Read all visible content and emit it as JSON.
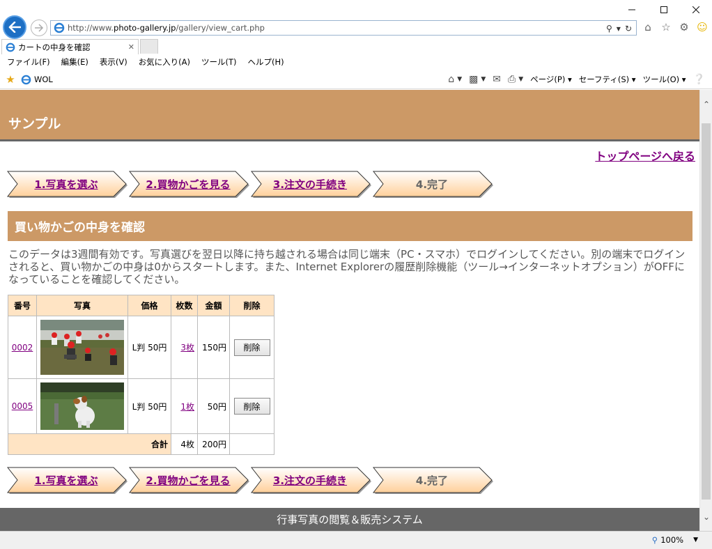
{
  "browser": {
    "url_prefix": "http://www.",
    "url_domain": "photo-gallery.jp",
    "url_path": "/gallery/view_cart.php",
    "tab_title": "カートの中身を確認",
    "menu": [
      "ファイル(F)",
      "編集(E)",
      "表示(V)",
      "お気に入り(A)",
      "ツール(T)",
      "ヘルプ(H)"
    ],
    "favorite": "WOL",
    "cmd": {
      "page": "ページ(P)",
      "safety": "セーフティ(S)",
      "tools": "ツール(O)"
    },
    "zoom": "100%"
  },
  "site": {
    "title": "サンプル",
    "top_link": "トップページへ戻る",
    "footer": "行事写真の閲覧＆販売システム"
  },
  "steps": [
    {
      "label": "1.写真を選ぶ",
      "link": true
    },
    {
      "label": "2.買物かごを見る",
      "link": true
    },
    {
      "label": "3.注文の手続き",
      "link": true
    },
    {
      "label": "4.完了",
      "link": false
    }
  ],
  "section": {
    "heading": "買い物かごの中身を確認",
    "notice": "このデータは3週間有効です。写真選びを翌日以降に持ち越される場合は同じ端末（PC・スマホ）でログインしてください。別の端末でログインされると、買い物かごの中身は0からスタートします。また、Internet Explorerの履歴削除機能（ツール→インターネットオプション）がOFFになっていることを確認してください。"
  },
  "cart": {
    "headers": [
      "番号",
      "写真",
      "価格",
      "枚数",
      "金額",
      "削除"
    ],
    "rows": [
      {
        "num": "0002",
        "price": "L判 50円",
        "qty": "3枚",
        "amount": "150円",
        "delete": "削除",
        "photo": "children-playing-photo"
      },
      {
        "num": "0005",
        "price": "L判 50円",
        "qty": "1枚",
        "amount": "50円",
        "delete": "削除",
        "photo": "dog-photo"
      }
    ],
    "total_label": "合計",
    "total_qty": "4枚",
    "total_amount": "200円"
  }
}
